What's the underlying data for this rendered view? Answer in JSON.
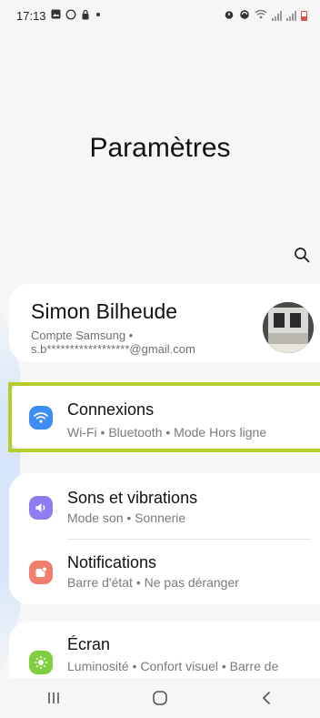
{
  "status_bar": {
    "time": "17:13",
    "left_icons": [
      "gallery-icon",
      "whatsapp-icon",
      "lock-icon",
      "dot-icon"
    ],
    "right_icons": [
      "alarm-icon",
      "sync-icon",
      "wifi-icon",
      "signal-icon",
      "signal-icon",
      "battery-icon"
    ],
    "battery_color": "#d9534f"
  },
  "header": {
    "title": "Paramètres"
  },
  "search": {
    "icon": "search-icon"
  },
  "account": {
    "name": "Simon Bilheude",
    "subtitle_line1": "Compte Samsung  •",
    "subtitle_line2": "s.b******************@gmail.com"
  },
  "settings": {
    "connexions": {
      "title": "Connexions",
      "subtitle": "Wi-Fi  •  Bluetooth  •  Mode Hors ligne",
      "icon": "wifi-icon",
      "color": "#3e8df5",
      "highlight_color": "#b5cc2a"
    },
    "sons": {
      "title": "Sons et vibrations",
      "subtitle": "Mode son  •  Sonnerie",
      "icon": "speaker-icon",
      "color": "#8f7cf0"
    },
    "notifications": {
      "title": "Notifications",
      "subtitle": "Barre d'état  •  Ne pas déranger",
      "icon": "notification-icon",
      "color": "#f07e6c"
    },
    "ecran": {
      "title": "Écran",
      "subtitle": "Luminosité  •  Confort visuel  •  Barre de navigation",
      "icon": "sun-icon",
      "color": "#7fcf3e"
    }
  },
  "navigation": {
    "recents": "recents-icon",
    "home": "home-icon",
    "back": "back-icon"
  }
}
